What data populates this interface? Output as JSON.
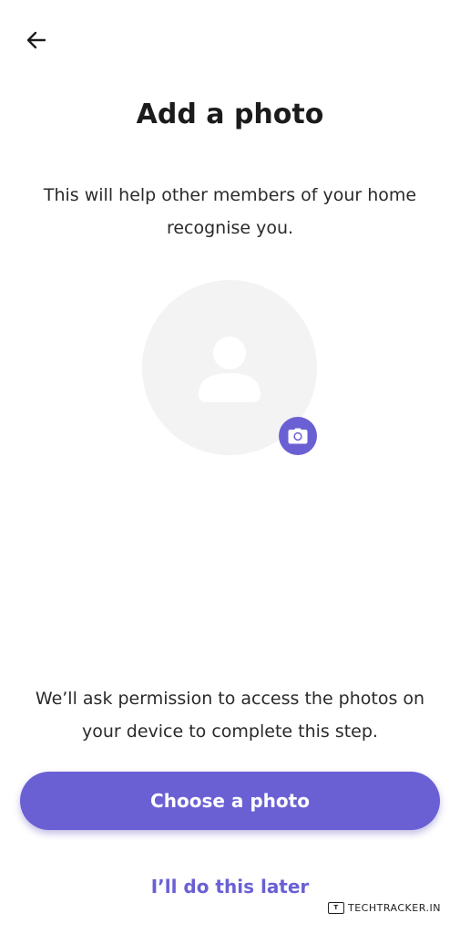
{
  "header": {
    "back_icon": "arrow-left-icon"
  },
  "content": {
    "title": "Add a photo",
    "subtitle": "This will help other members of your home recognise you.",
    "avatar_icon": "user-silhouette-icon",
    "camera_icon": "camera-icon",
    "permission_note": "We’ll ask permission to access the photos on your device to complete this step."
  },
  "actions": {
    "choose_label": "Choose a photo",
    "later_label": "I’ll do this later"
  },
  "watermark": {
    "text": "TECHTRACKER.IN"
  },
  "colors": {
    "accent": "#6a60d4",
    "avatar_bg": "#f3f3f3",
    "background": "#ffffff"
  }
}
